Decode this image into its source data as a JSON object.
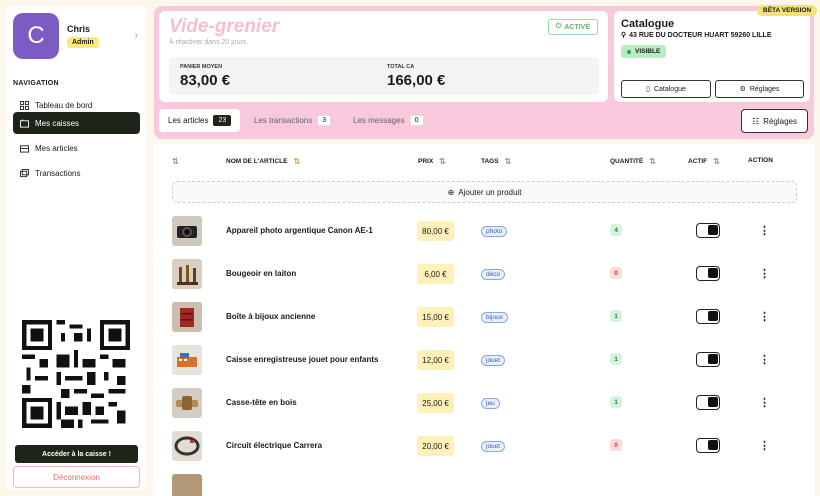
{
  "user": {
    "initial": "C",
    "name": "Chris",
    "role": "Admin"
  },
  "nav": {
    "title": "NAVIGATION",
    "items": [
      {
        "label": "Tableau de bord",
        "icon": "dashboard-icon"
      },
      {
        "label": "Mes caisses",
        "icon": "register-icon",
        "active": true
      },
      {
        "label": "Mes articles",
        "icon": "article-icon"
      },
      {
        "label": "Transactions",
        "icon": "transactions-icon"
      }
    ]
  },
  "sidebar_actions": {
    "caisse": "Accéder à la caisse !",
    "logout": "Déconnexion"
  },
  "event": {
    "title": "Vide-grenier",
    "subtitle": "À réactiver dans 20 jours",
    "status": "ACTIVÉ",
    "stats": [
      {
        "label": "PANIER MOYEN",
        "value": "83,00 €"
      },
      {
        "label": "TOTAL CA",
        "value": "166,00 €"
      }
    ]
  },
  "catalogue": {
    "badge": "BÊTA VERSION",
    "title": "Catalogue",
    "address": "43 RUE DU DOCTEUR HUART 59260 LILLE",
    "visibility": "VISIBLE",
    "btn_catalogue": "Catalogue",
    "btn_reglages": "Réglages"
  },
  "tabs": [
    {
      "label": "Les articles",
      "count": "23",
      "active": true
    },
    {
      "label": "Les transactions",
      "count": "3"
    },
    {
      "label": "Les messages",
      "count": "0"
    }
  ],
  "reglages_button": "Réglages",
  "table": {
    "headers": {
      "name": "NOM DE L'ARTICLE",
      "price": "PRIX",
      "tags": "TAGS",
      "qty": "QUANTITÉ",
      "active": "ACTIF",
      "action": "ACTION"
    },
    "add_label": "Ajouter un produit",
    "rows": [
      {
        "name": "Appareil photo argentique Canon AE-1",
        "price": "80,00 €",
        "tag": "photo",
        "qty": "4",
        "qty_zero": false
      },
      {
        "name": "Bougeoir en laiton",
        "price": "6,00 €",
        "tag": "déco",
        "qty": "0",
        "qty_zero": true
      },
      {
        "name": "Boîte à bijoux ancienne",
        "price": "15,00 €",
        "tag": "bijoux",
        "qty": "1",
        "qty_zero": false
      },
      {
        "name": "Caisse enregistreuse jouet pour enfants",
        "price": "12,00 €",
        "tag": "jouet",
        "qty": "1",
        "qty_zero": false
      },
      {
        "name": "Casse-tête en bois",
        "price": "25,00 €",
        "tag": "jeu",
        "qty": "1",
        "qty_zero": false
      },
      {
        "name": "Circuit électrique Carrera",
        "price": "20,00 €",
        "tag": "jouet",
        "qty": "0",
        "qty_zero": true
      }
    ]
  }
}
